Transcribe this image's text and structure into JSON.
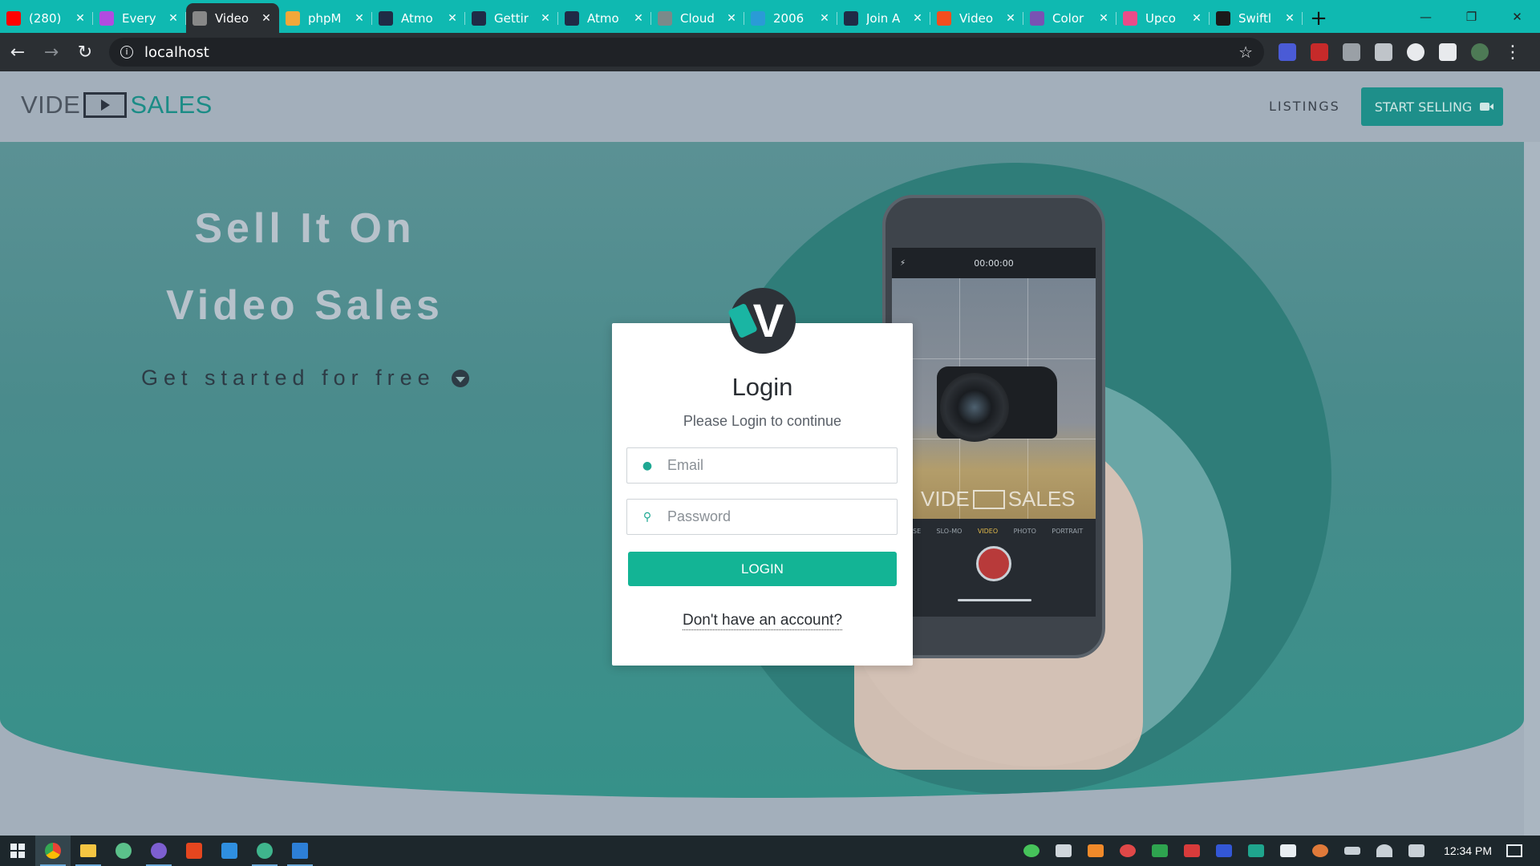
{
  "browser": {
    "tabs": [
      {
        "title": "(280)",
        "icon": "youtube-icon",
        "color": "#ff0000"
      },
      {
        "title": "Every",
        "icon": "app-icon",
        "color": "#b14be0"
      },
      {
        "title": "Video",
        "icon": "globe-icon",
        "color": "#888888",
        "active": true
      },
      {
        "title": "phpM",
        "icon": "phpmyadmin-icon",
        "color": "#f1a83a"
      },
      {
        "title": "Atmo",
        "icon": "atmo-icon",
        "color": "#1f2b46"
      },
      {
        "title": "Gettir",
        "icon": "atmo-icon",
        "color": "#1f2b46"
      },
      {
        "title": "Atmo",
        "icon": "atmo-icon",
        "color": "#1f2b46"
      },
      {
        "title": "Cloud",
        "icon": "globe-icon",
        "color": "#7a8a8a"
      },
      {
        "title": "2006",
        "icon": "link-icon",
        "color": "#2a9bd6"
      },
      {
        "title": "Join A",
        "icon": "join-icon",
        "color": "#1f2b46"
      },
      {
        "title": "Video",
        "icon": "figma-icon",
        "color": "#f24e1e"
      },
      {
        "title": "Color",
        "icon": "bootstrap-icon",
        "color": "#7952b3"
      },
      {
        "title": "Upco",
        "icon": "dribbble-icon",
        "color": "#ea4c89"
      },
      {
        "title": "Swiftl",
        "icon": "swiftly-icon",
        "color": "#1a1a1a"
      }
    ],
    "new_tab": "+",
    "address": "localhost"
  },
  "site": {
    "logo": {
      "word1": "VIDE",
      "word2": "SALES"
    },
    "nav_listings": "LISTINGS",
    "start_selling": "START SELLING",
    "accent": "#1e8f8a"
  },
  "hero": {
    "title_line1": "Sell It On",
    "title_line2": "Video Sales",
    "subtitle": "Get started for free"
  },
  "phone": {
    "timer": "00:00:00",
    "watermark_word1": "VIDE",
    "watermark_word2": "SALES",
    "modes": [
      "APSE",
      "SLO-MO",
      "VIDEO",
      "PHOTO",
      "PORTRAIT"
    ]
  },
  "login": {
    "title": "Login",
    "subtitle": "Please Login to continue",
    "email_placeholder": "Email",
    "password_placeholder": "Password",
    "button": "LOGIN",
    "register_link": "Don't have an account?",
    "button_color": "#13b495"
  },
  "taskbar": {
    "clock": "12:34 PM"
  }
}
